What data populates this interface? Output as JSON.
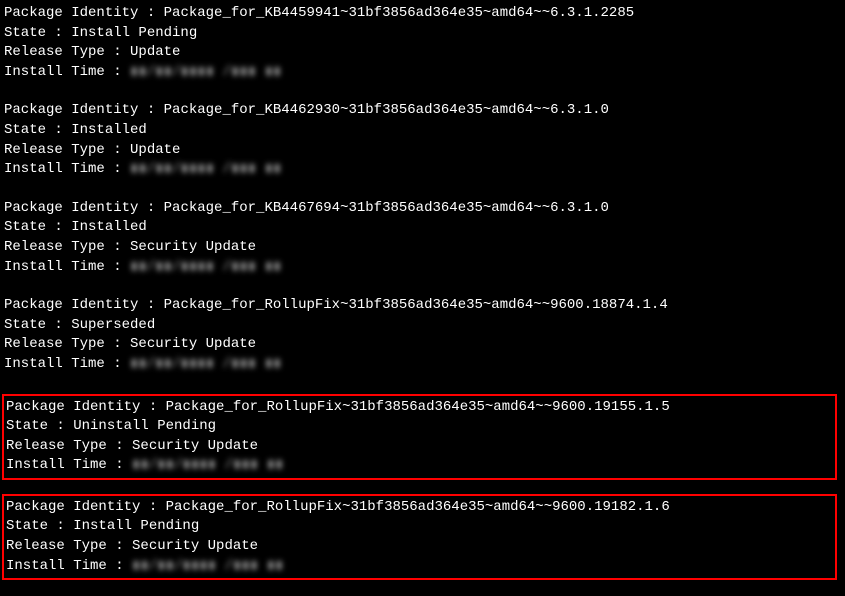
{
  "packages": [
    {
      "identity_label": "Package Identity : ",
      "identity_value": "Package_for_KB4459941~31bf3856ad364e35~amd64~~6.3.1.2285",
      "state_label": "State : ",
      "state_value": "Install Pending",
      "release_label": "Release Type : ",
      "release_value": "Update",
      "install_label": "Install Time : ",
      "install_value": "▮▮/▮▮/▮▮▮▮ /▮▮▮ ▮▮",
      "highlighted": false
    },
    {
      "identity_label": "Package Identity : ",
      "identity_value": "Package_for_KB4462930~31bf3856ad364e35~amd64~~6.3.1.0",
      "state_label": "State : ",
      "state_value": "Installed",
      "release_label": "Release Type : ",
      "release_value": "Update",
      "install_label": "Install Time : ",
      "install_value": "▮▮/▮▮/▮▮▮▮ /▮▮▮ ▮▮",
      "highlighted": false
    },
    {
      "identity_label": "Package Identity : ",
      "identity_value": "Package_for_KB4467694~31bf3856ad364e35~amd64~~6.3.1.0",
      "state_label": "State : ",
      "state_value": "Installed",
      "release_label": "Release Type : ",
      "release_value": "Security Update",
      "install_label": "Install Time : ",
      "install_value": "▮▮/▮▮/▮▮▮▮ /▮▮▮ ▮▮",
      "highlighted": false
    },
    {
      "identity_label": "Package Identity : ",
      "identity_value": "Package_for_RollupFix~31bf3856ad364e35~amd64~~9600.18874.1.4",
      "state_label": "State : ",
      "state_value": "Superseded",
      "release_label": "Release Type : ",
      "release_value": "Security Update",
      "install_label": "Install Time : ",
      "install_value": "▮▮/▮▮/▮▮▮▮ /▮▮▮ ▮▮",
      "highlighted": false
    },
    {
      "identity_label": "Package Identity : ",
      "identity_value": "Package_for_RollupFix~31bf3856ad364e35~amd64~~9600.19155.1.5",
      "state_label": "State : ",
      "state_value": "Uninstall Pending",
      "release_label": "Release Type : ",
      "release_value": "Security Update",
      "install_label": "Install Time : ",
      "install_value": "▮▮/▮▮/▮▮▮▮ /▮▮▮ ▮▮",
      "highlighted": true
    },
    {
      "identity_label": "Package Identity : ",
      "identity_value": "Package_for_RollupFix~31bf3856ad364e35~amd64~~9600.19182.1.6",
      "state_label": "State : ",
      "state_value": "Install Pending",
      "release_label": "Release Type : ",
      "release_value": "Security Update",
      "install_label": "Install Time : ",
      "install_value": "▮▮/▮▮/▮▮▮▮ /▮▮▮ ▮▮",
      "highlighted": true
    }
  ]
}
